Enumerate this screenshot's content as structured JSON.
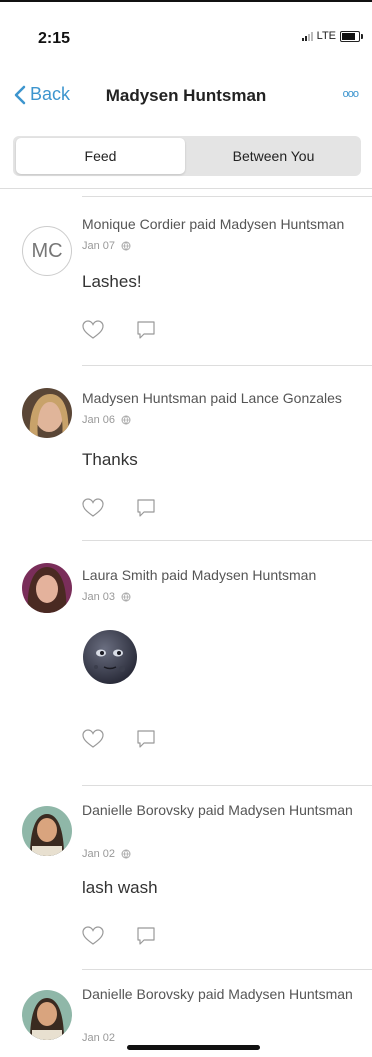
{
  "status": {
    "time": "2:15",
    "network": "LTE"
  },
  "nav": {
    "back_label": "Back",
    "title": "Madysen Huntsman",
    "more_label": "ooo"
  },
  "tabs": [
    {
      "label": "Feed",
      "active": true
    },
    {
      "label": "Between You",
      "active": false
    }
  ],
  "feed": [
    {
      "avatar_initials": "MC",
      "headline": "Monique Cordier paid Madysen Huntsman",
      "date": "Jan 07",
      "note": "Lashes!"
    },
    {
      "headline": "Madysen Huntsman paid Lance Gonzales",
      "date": "Jan 06",
      "note": "Thanks"
    },
    {
      "headline": "Laura Smith paid Madysen Huntsman",
      "date": "Jan 03",
      "note_emoji": "new-moon-face"
    },
    {
      "headline": "Danielle Borovsky paid Madysen Huntsman",
      "date": "Jan 02",
      "note": "lash wash"
    },
    {
      "headline": "Danielle Borovsky paid Madysen Huntsman",
      "date": "Jan 02"
    }
  ],
  "colors": {
    "accent": "#3d95ce",
    "segment_bg": "#e4e4e4"
  }
}
